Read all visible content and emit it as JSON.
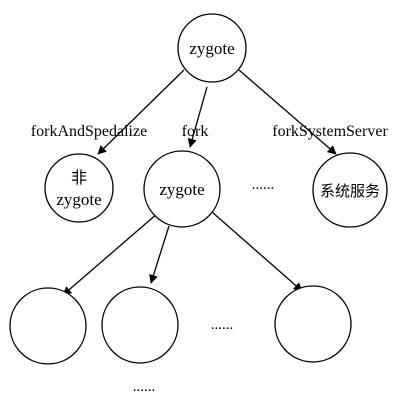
{
  "nodes": {
    "root": "zygote",
    "non_zygote_line1": "非",
    "non_zygote_line2": "zygote",
    "child": "zygote",
    "system_services": "系统服务"
  },
  "edges": {
    "fork_and_specialize": "forkAndSpedalize",
    "fork": "fork",
    "fork_system_server": "forkSystemServer"
  },
  "ellipses": {
    "row2": "......",
    "row3": "......",
    "bottom": "......"
  },
  "colors": {
    "stroke": "#000000",
    "fill": "#ffffff"
  }
}
